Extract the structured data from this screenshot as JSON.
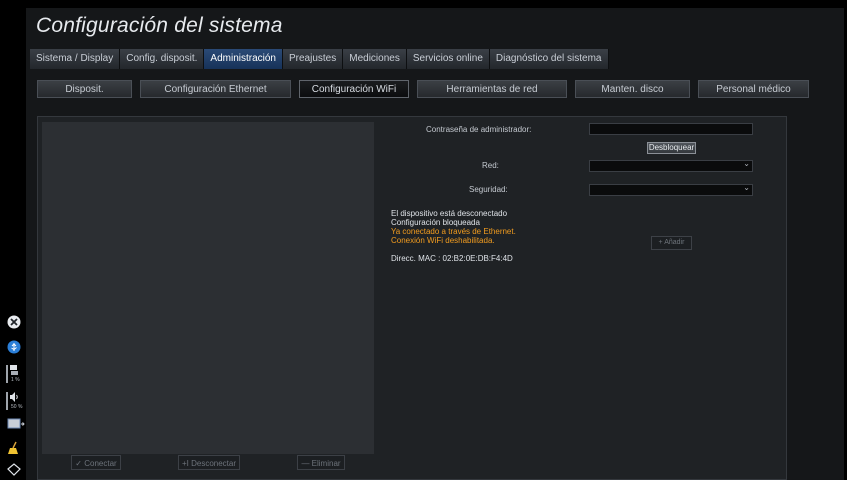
{
  "window": {
    "title": "Configuración del sistema"
  },
  "tabs": [
    {
      "label": "Sistema / Display",
      "active": false
    },
    {
      "label": "Config. disposit.",
      "active": false
    },
    {
      "label": "Administración",
      "active": true
    },
    {
      "label": "Preajustes",
      "active": false
    },
    {
      "label": "Mediciones",
      "active": false
    },
    {
      "label": "Servicios online",
      "active": false
    },
    {
      "label": "Diagnóstico del sistema",
      "active": false
    }
  ],
  "subtabs": [
    {
      "label": "Disposit.",
      "active": false
    },
    {
      "label": "Configuración Ethernet",
      "active": false
    },
    {
      "label": "Configuración WiFi",
      "active": true
    },
    {
      "label": "Herramientas de red",
      "active": false
    },
    {
      "label": "Manten. disco",
      "active": false
    },
    {
      "label": "Personal médico",
      "active": false
    }
  ],
  "network_list": {
    "connect_label": "✓ Conectar",
    "disconnect_label": "+I Desconectar",
    "delete_label": "— Eliminar"
  },
  "form": {
    "password_label": "Contraseña de administrador:",
    "password_value": "",
    "unlock_label": "Desbloquear",
    "network_label": "Red:",
    "network_value": "",
    "security_label": "Seguridad:",
    "security_value": "",
    "add_label": "+ Añadir"
  },
  "status": {
    "line1": "El dispositivo está desconectado",
    "line2": "Configuración bloqueada",
    "warning1": "Ya conectado a través de Ethernet.",
    "warning2": "Conexión WiFi deshabilitada.",
    "mac": "Direcc. MAC : 02:B2:0E:DB:F4:4D"
  },
  "sidebar": {
    "disk_percent": "1 %",
    "volume_percent": "50 %"
  },
  "colors": {
    "active_tab": "#1f3d69",
    "warning_text": "#f29c1f",
    "background": "#151719"
  }
}
